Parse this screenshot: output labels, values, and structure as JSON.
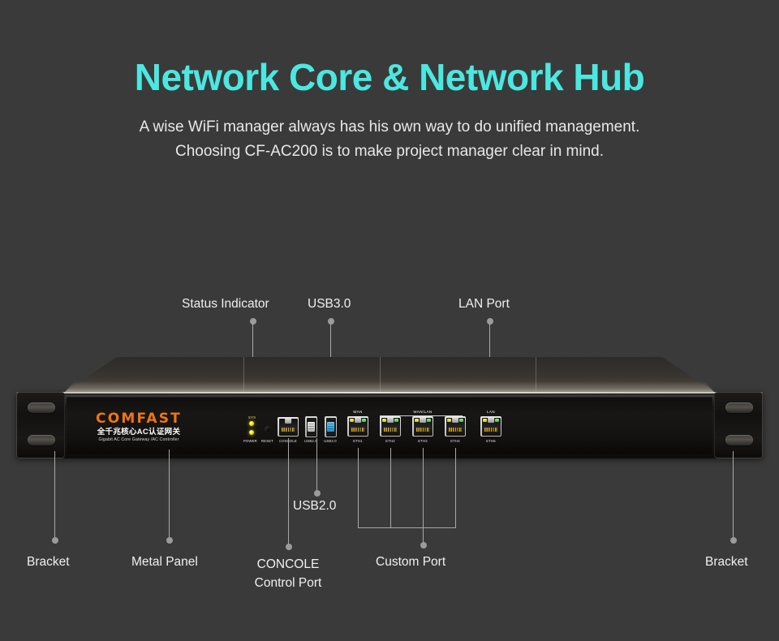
{
  "header": {
    "title": "Network Core & Network Hub",
    "subtitle_line1": "A wise WiFi manager always has his own way to do unified management.",
    "subtitle_line2": "Choosing CF-AC200 is to make project manager clear in mind.",
    "title_color": "#4ae8e0",
    "subtitle_color": "#e8e8e8"
  },
  "background_color": "#3a3a3a",
  "device": {
    "model": "CF-AC200",
    "brand": "COMFAST",
    "brand_color": "#ef7419",
    "subtitle_cn": "全千兆核心AC认证网关",
    "subtitle_en": "Gigabit AC Core Gateway /AC Controller",
    "indicators": {
      "sys_label": "SYS",
      "power_label": "POWER",
      "reset_label": "RESET",
      "led_color": "#e8e010"
    },
    "ports": {
      "console_label": "CONSOLE",
      "usb2_label": "USB2.0",
      "usb3_label": "USB3.0",
      "usb3_color": "#1a8fd0",
      "eth_group_wan": "WAN",
      "eth_group_wanlan": "WAN/LAN",
      "eth_group_lan": "LAN",
      "eth_labels": [
        "ETH1",
        "ETH2",
        "ETH3",
        "ETH4",
        "ETH5"
      ]
    }
  },
  "annotations": {
    "status_indicator": "Status Indicator",
    "usb30": "USB3.0",
    "lan_port": "LAN Port",
    "usb20": "USB2.0",
    "bracket_left": "Bracket",
    "metal_panel": "Metal Panel",
    "concole_line1": "CONCOLE",
    "concole_line2": "Control Port",
    "custom_port": "Custom Port",
    "bracket_right": "Bracket",
    "leader_color": "#a8a8a8"
  }
}
